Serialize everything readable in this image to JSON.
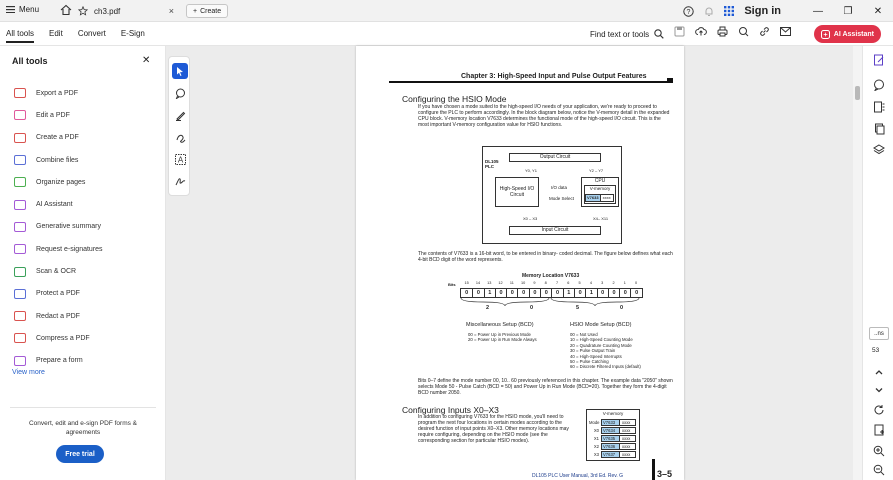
{
  "titlebar": {
    "menu_label": "Menu",
    "tab_title": "ch3.pdf",
    "tab_close": "×",
    "new_tab_label": "Create",
    "sign_in": "Sign in"
  },
  "toolbar": {
    "menus": [
      "All tools",
      "Edit",
      "Convert",
      "E-Sign"
    ],
    "find_label": "Find text or tools",
    "ai_assistant": "AI Assistant"
  },
  "left_panel": {
    "title": "All tools",
    "items": [
      {
        "label": "Export a PDF",
        "color": "#d9534f"
      },
      {
        "label": "Edit a PDF",
        "color": "#e05a9b"
      },
      {
        "label": "Create a PDF",
        "color": "#d9534f"
      },
      {
        "label": "Combine files",
        "color": "#5b6fd6"
      },
      {
        "label": "Organize pages",
        "color": "#4caf50"
      },
      {
        "label": "AI Assistant",
        "color": "#a45ad6"
      },
      {
        "label": "Generative summary",
        "color": "#a45ad6"
      },
      {
        "label": "Request e-signatures",
        "color": "#a45ad6"
      },
      {
        "label": "Scan & OCR",
        "color": "#3aa05a"
      },
      {
        "label": "Protect a PDF",
        "color": "#5b6fd6"
      },
      {
        "label": "Redact a PDF",
        "color": "#d9534f"
      },
      {
        "label": "Compress a PDF",
        "color": "#d9534f"
      },
      {
        "label": "Prepare a form",
        "color": "#a45ad6"
      }
    ],
    "view_more": "View more",
    "promo_text": "Convert, edit and e-sign PDF forms & agreements",
    "free_trial": "Free trial"
  },
  "document": {
    "chapter_title": "Chapter 3: High-Speed Input and Pulse Output Features",
    "section1_title": "Configuring the HSIO Mode",
    "section1_para": "If you have chosen a mode suited to the high-speed I/O needs of your application, we're ready to proceed to configure the PLC to perform accordingly. In the block diagram below, notice the V-memory detail in the expanded CPU block. V-memory location V7633 determines the functional mode of the high-speed I/O circuit. This is the most important V-memory configuration value for HSIO functions.",
    "diagram": {
      "plc_label": "DL105 PLC",
      "output_circuit": "Output Circuit",
      "y01": "Y0, Y1",
      "y27": "Y2 – Y7",
      "hsio_circuit": "High-Speed I/O Circuit",
      "io_data": "I/O data",
      "mode_select": "Mode Select",
      "cpu": "CPU",
      "vmemory": "V-memory",
      "v7633": "V7633",
      "xxxx": "xxxx",
      "x03": "X0 – X3",
      "x411": "X4– X11",
      "input_circuit": "Input Circuit"
    },
    "para2": "The contents of V7633 is a 16-bit word, to be entered in binary- coded decimal. The figure below defines what each 4-bit BCD digit of the word represents.",
    "memory_title": "Memory Location V7633",
    "bits_label": "Bits",
    "bit_numbers": [
      "15",
      "14",
      "13",
      "12",
      "11",
      "10",
      "9",
      "8",
      "7",
      "6",
      "5",
      "4",
      "3",
      "2",
      "1",
      "0"
    ],
    "bit_values": [
      "0",
      "0",
      "1",
      "0",
      "0",
      "0",
      "0",
      "0",
      "0",
      "1",
      "0",
      "1",
      "0",
      "0",
      "0",
      "0"
    ],
    "digits": [
      "2",
      "0",
      "5",
      "0"
    ],
    "misc_setup": "Miscellaneous Setup (BCD)",
    "misc_items": [
      "00 = Power Up in Previous Mode",
      "20 = Power Up in Run Mode Always"
    ],
    "hsio_setup": "HSIO Mode Setup (BCD)",
    "hsio_items": [
      "00 = Not Used",
      "10 = High-Speed Counting Mode",
      "20 = Quadrature Counting Mode",
      "30 = Pulse Output Train",
      "40 = High-Speed Interrupts",
      "50 = Pulse Catching",
      "60 = Discrete Filtered Inputs (default)"
    ],
    "para3": "Bits 0–7 define the mode number 00, 10.. 60 previously referenced in this chapter. The example data \"2050\" shown selects Mode 50 - Pulse Catch (BCD = 50) and Power Up in Run Mode (BCD=20). Together they form the 4-digit BCD number 2050.",
    "section2_title": "Configuring Inputs X0–X3",
    "section2_para": "In addition to configuring V7633 for the HSIO mode, you'll need to program the next four locations in certain modes according to the desired function of input points X0–X3. Other memory locations may require configuring, depending on the HSIO mode (see the corresponding section for particular HSIO modes).",
    "vtable": {
      "title": "V-memory",
      "rows": [
        {
          "label": "Mode",
          "addr": "V7633",
          "val": "xxxx"
        },
        {
          "label": "X0",
          "addr": "V7634",
          "val": "xxxx"
        },
        {
          "label": "X1",
          "addr": "V7635",
          "val": "xxxx"
        },
        {
          "label": "X2",
          "addr": "V7636",
          "val": "xxxx"
        },
        {
          "label": "X3",
          "addr": "V7637",
          "val": "xxxx"
        }
      ]
    },
    "footer": "DL105 PLC User Manual, 3rd Ed. Rev. G",
    "page_number": "3–5"
  },
  "right_bar": {
    "page_box": "..ns",
    "page_total": "53"
  }
}
